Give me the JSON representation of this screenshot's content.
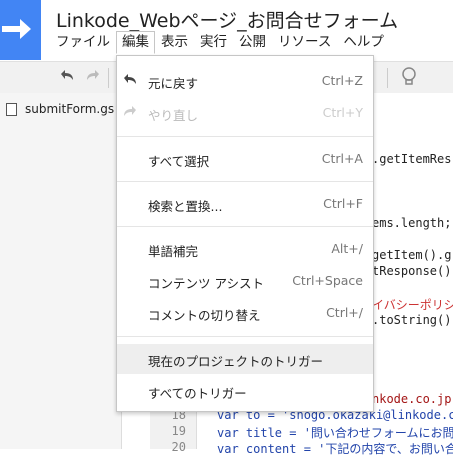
{
  "app": {
    "title": "Linkode_Webページ_お問合せフォーム"
  },
  "menubar": {
    "items": [
      {
        "label": "ファイル"
      },
      {
        "label": "編集"
      },
      {
        "label": "表示"
      },
      {
        "label": "実行"
      },
      {
        "label": "公開"
      },
      {
        "label": "リソース"
      },
      {
        "label": "ヘルプ"
      }
    ]
  },
  "sidebar": {
    "file_name": "submitForm.gs"
  },
  "editor": {
    "visible_fragments": [
      ".getItemRes",
      "ems.length;",
      "getItem().g",
      "tResponse()",
      "イバシーポリシ",
      ".toString()",
      "nkode.co.jp"
    ],
    "lines": [
      {
        "no": "18",
        "text": "var to = 'shogo.okazaki@linkode.c"
      },
      {
        "no": "19",
        "text": "var title = '問い合わせフォームにお問"
      },
      {
        "no": "20",
        "text": "var content = '下記の内容で、お問い合"
      }
    ]
  },
  "edit_menu": {
    "undo": {
      "label": "元に戻す",
      "shortcut": "Ctrl+Z",
      "icon": "undo-icon"
    },
    "redo": {
      "label": "やり直し",
      "shortcut": "Ctrl+Y",
      "icon": "redo-icon"
    },
    "select_all": {
      "label": "すべて選択",
      "shortcut": "Ctrl+A"
    },
    "find_replace": {
      "label": "検索と置換...",
      "shortcut": "Ctrl+F"
    },
    "word_complete": {
      "label": "単語補完",
      "shortcut": "Alt+/"
    },
    "content_assist": {
      "label": "コンテンツ アシスト",
      "shortcut": "Ctrl+Space"
    },
    "toggle_comment": {
      "label": "コメントの切り替え",
      "shortcut": "Ctrl+/"
    },
    "project_triggers": {
      "label": "現在のプロジェクトのトリガー"
    },
    "all_triggers": {
      "label": "すべてのトリガー"
    }
  }
}
